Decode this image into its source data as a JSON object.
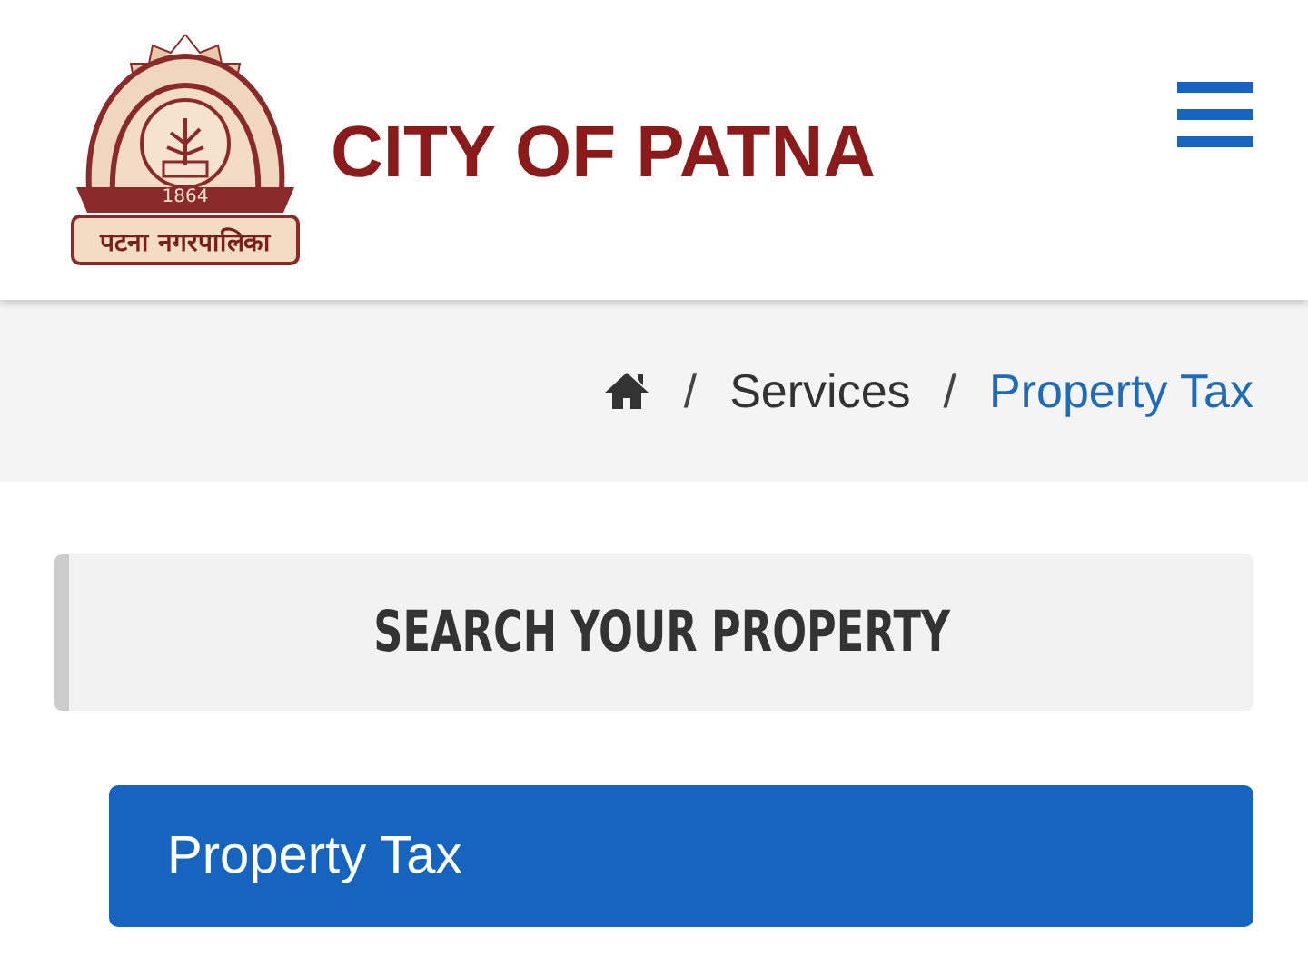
{
  "header": {
    "logo": {
      "year": "1864",
      "banner": "पटना नगरपालिका"
    },
    "site_title": "CITY OF PATNA"
  },
  "breadcrumb_separator": "/",
  "breadcrumb": [
    {
      "kind": "home"
    },
    {
      "kind": "link",
      "label": "Services"
    },
    {
      "kind": "current",
      "label": "Property Tax"
    }
  ],
  "section_title": "SEARCH YOUR PROPERTY",
  "panel": {
    "title": "Property Tax"
  }
}
